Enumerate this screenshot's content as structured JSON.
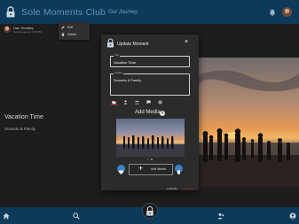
{
  "app": {
    "name": "Sole Moments Club",
    "subtitle": "Our Journey",
    "brand_color": "#0e3a5a",
    "accent_red": "#b21f2d",
    "accent_blue": "#3d82c4"
  },
  "post": {
    "user": "Dan Smalley",
    "time": "Sunday ago at 4:42 PM"
  },
  "context_menu": {
    "items": [
      {
        "label": "Edit",
        "icon": "pencil-icon"
      },
      {
        "label": "Delete",
        "icon": "trash-icon"
      }
    ]
  },
  "moment": {
    "title": "Vacation Time",
    "caption": "Sunsets & Family"
  },
  "dialog": {
    "title": "Update Moment",
    "close_glyph": "×",
    "title_field": {
      "label": "Title",
      "value": "Vacation Time"
    },
    "caption_field": {
      "label": "Caption",
      "value": "Sunsets & Family"
    },
    "toolbar_icons": [
      "folder-icon",
      "people-icon",
      "group-icon",
      "comment-icon",
      "settings-icon"
    ],
    "add_media_heading": "Add Media",
    "help_glyph": "?",
    "add_media_button": "Add Media",
    "plus_glyph": "+",
    "cancel_label": "CANCEL",
    "update_label": "UPDATE"
  },
  "bottom_nav": {
    "icons": [
      "home-icon",
      "search-icon",
      "moments-lock-icon",
      "add-person-icon",
      "profile-icon"
    ]
  }
}
